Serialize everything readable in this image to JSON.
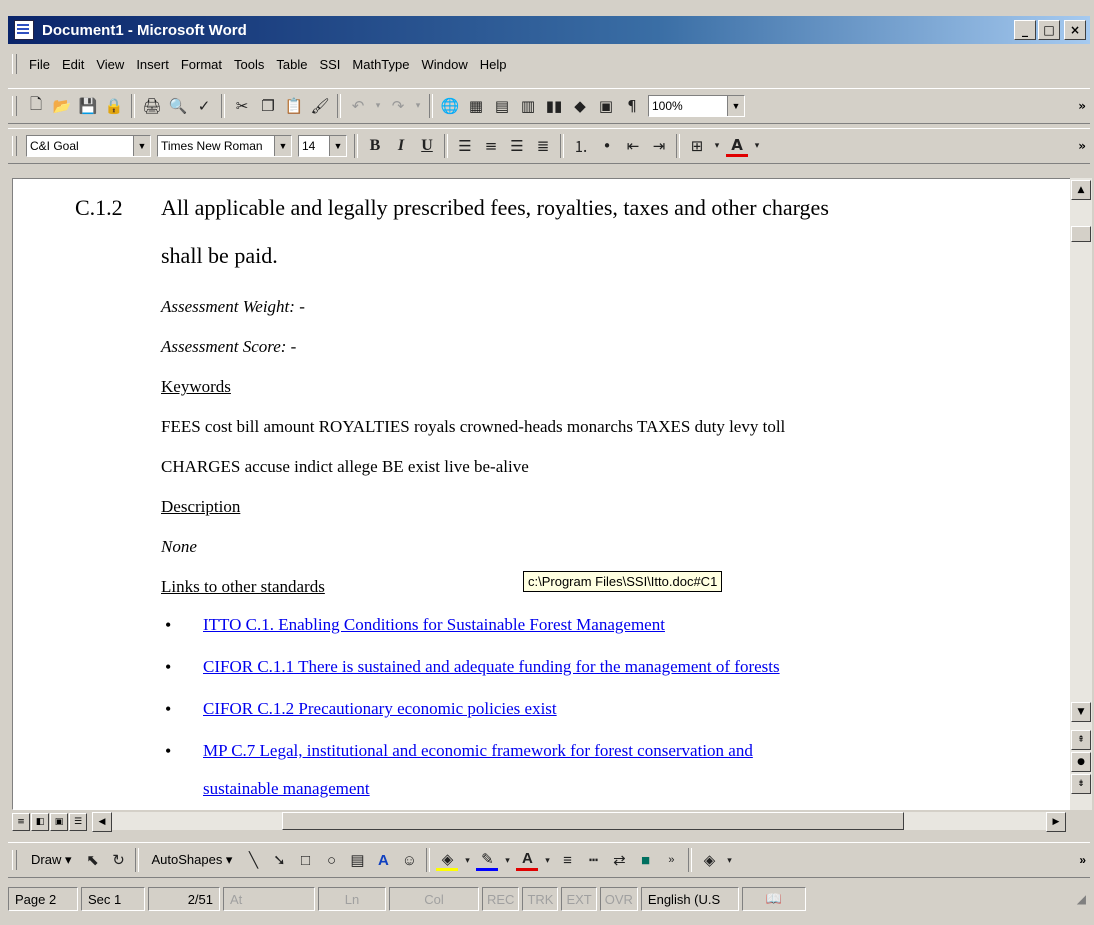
{
  "window": {
    "title": "Document1 - Microsoft Word",
    "min": "_",
    "max": "□",
    "close": "×"
  },
  "menu": [
    "File",
    "Edit",
    "View",
    "Insert",
    "Format",
    "Tools",
    "Table",
    "SSI",
    "MathType",
    "Window",
    "Help"
  ],
  "toolbar": {
    "zoom": "100%"
  },
  "format_bar": {
    "style": "C&I Goal",
    "font": "Times New Roman",
    "size": "14",
    "bold": "B",
    "italic": "I",
    "underline": "U"
  },
  "document": {
    "number": "C.1.2",
    "heading_line1": "All applicable and legally prescribed fees, royalties, taxes and other charges",
    "heading_line2": "shall be paid.",
    "weight": "Assessment Weight: -",
    "score": "Assessment Score: -",
    "keywords_label": "Keywords",
    "keywords_line1": "FEES cost bill amount ROYALTIES royals crowned-heads monarchs TAXES duty levy toll",
    "keywords_line2": "CHARGES accuse indict allege BE exist live be-alive",
    "description_label": "Description",
    "description_value": "None",
    "links_label": "Links to other standards",
    "tooltip": "c:\\Program Files\\SSI\\Itto.doc#C1",
    "links": [
      "ITTO C.1. Enabling Conditions for Sustainable Forest Management",
      "CIFOR C.1.1 There is sustained and adequate funding for the management of forests",
      "CIFOR C.1.2 Precautionary economic policies exist",
      "MP C.7 Legal, institutional and economic framework for forest conservation and",
      "sustainable management"
    ]
  },
  "drawbar": {
    "draw": "Draw ▾",
    "autoshapes": "AutoShapes ▾"
  },
  "status": {
    "page": "Page 2",
    "sec": "Sec 1",
    "pos": "2/51",
    "at": "At",
    "ln": "Ln",
    "col": "Col",
    "rec": "REC",
    "trk": "TRK",
    "ext": "EXT",
    "ovr": "OVR",
    "lang": "English (U.S"
  }
}
